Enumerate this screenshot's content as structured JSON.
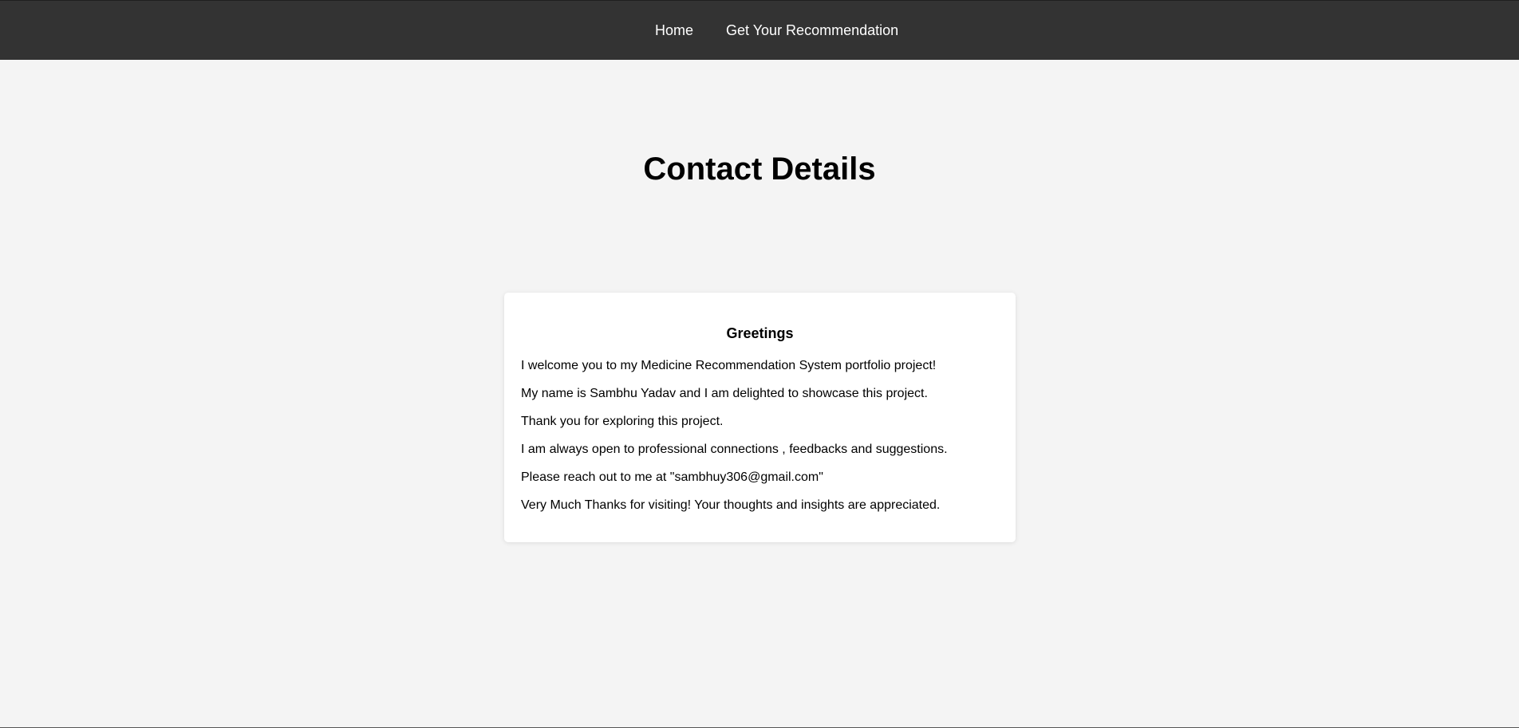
{
  "nav": {
    "home_label": "Home",
    "recommendation_label": "Get Your Recommendation"
  },
  "main": {
    "title": "Contact Details"
  },
  "card": {
    "heading": "Greetings",
    "lines": [
      "I welcome you to my Medicine Recommendation System portfolio project!",
      "My name is Sambhu Yadav and I am delighted to showcase this project.",
      "Thank you for exploring this project.",
      "I am always open to professional connections , feedbacks and suggestions.",
      "Please reach out to me at \"sambhuy306@gmail.com\"",
      "Very Much Thanks for visiting! Your thoughts and insights are appreciated."
    ]
  },
  "colors": {
    "navbar_bg": "#333333",
    "page_bg": "#f4f4f4",
    "card_bg": "#ffffff",
    "nav_text": "#ffffff"
  }
}
